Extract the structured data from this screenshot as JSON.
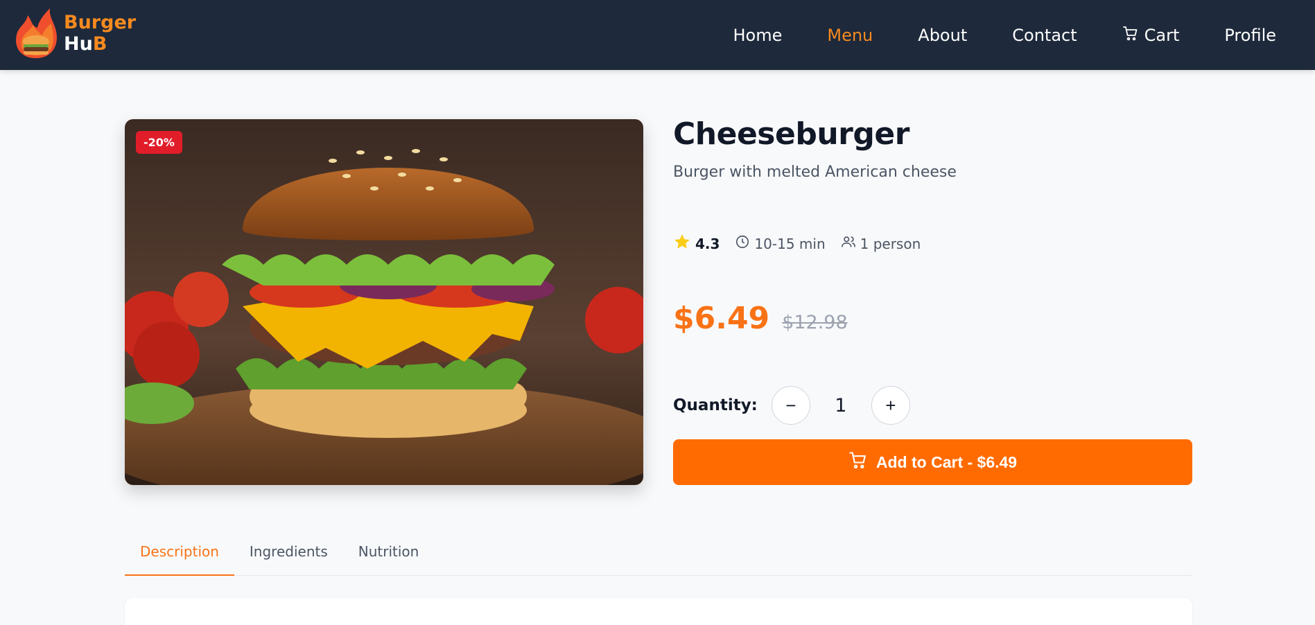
{
  "brand": {
    "line1": "Burger",
    "line2_main": "Hu",
    "line2_accent": "B",
    "accent_color": "#f68a1f"
  },
  "nav": {
    "home": "Home",
    "menu": "Menu",
    "about": "About",
    "contact": "Contact",
    "cart": "Cart",
    "profile": "Profile",
    "active": "Menu"
  },
  "product": {
    "discount": "-20%",
    "title": "Cheeseburger",
    "subtitle": "Burger with melted American cheese",
    "rating": "4.3",
    "prep_time": "10-15 min",
    "serves": "1 person",
    "price": "$6.49",
    "old_price": "$12.98"
  },
  "quantity": {
    "label": "Quantity:",
    "value": "1",
    "decrement": "−",
    "increment": "+"
  },
  "add_to_cart": {
    "label": "Add to Cart - $6.49"
  },
  "tabs": {
    "description": "Description",
    "ingredients": "Ingredients",
    "nutrition": "Nutrition",
    "active": "Description"
  },
  "colors": {
    "navbar": "#1e293b",
    "accent": "#f97316",
    "button": "#ff6b00",
    "badge": "#e11d2a"
  },
  "icons": [
    "burger-logo-icon",
    "cart-icon",
    "star-icon",
    "clock-icon",
    "users-icon",
    "minus-icon",
    "plus-icon"
  ]
}
